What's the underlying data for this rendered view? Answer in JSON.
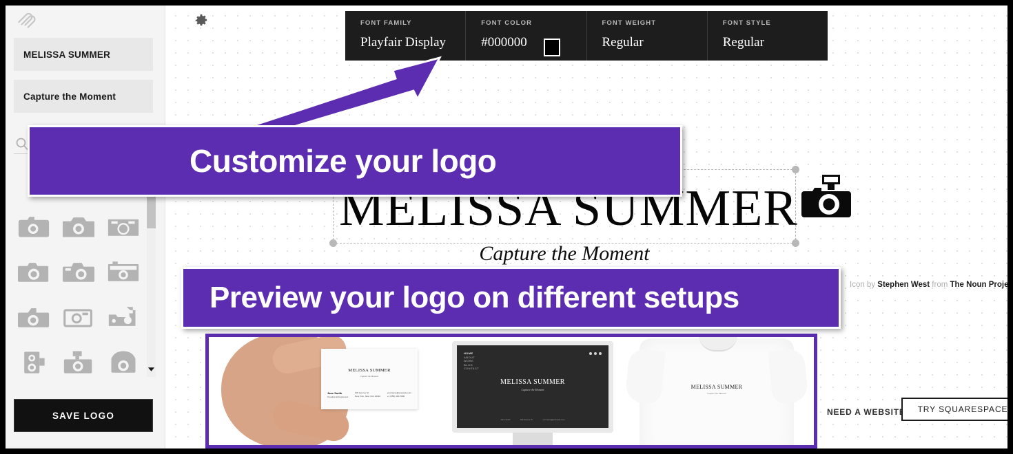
{
  "app": {
    "brand_icon": "squarespace-logo-icon",
    "accent_color": "#5c2db0",
    "canvas_bg": "#ffffff"
  },
  "sidebar": {
    "logo_name_field": {
      "label": "MELISSA SUMMER",
      "value": "MELISSA SUMMER"
    },
    "tagline_field": {
      "label": "Capture the Moment",
      "value": "Capture the Moment"
    },
    "search": {
      "icon": "search-icon",
      "placeholder": ""
    },
    "icon_grid": {
      "icon_name": "camera-icon",
      "rows": 4,
      "columns": 3,
      "count": 12
    },
    "save_button": "SAVE LOGO"
  },
  "toolbar": {
    "gear_icon": "gear-icon",
    "fields": [
      {
        "label": "FONT FAMILY",
        "value": "Playfair Display"
      },
      {
        "label": "FONT COLOR",
        "value": "#000000",
        "swatch": "#000000"
      },
      {
        "label": "FONT WEIGHT",
        "value": "Regular"
      },
      {
        "label": "FONT STYLE",
        "value": "Regular"
      }
    ]
  },
  "logo": {
    "title": "MELISSA SUMMER",
    "tagline": "Capture the Moment",
    "icon": "camera-with-flash-icon",
    "selected": true
  },
  "credit": {
    "prefix": "Icon by ",
    "author": "Stephen West",
    "middle": " from ",
    "source": "The Noun Project"
  },
  "previews": [
    {
      "name": "business-card",
      "logo": "MELISSA SUMMER",
      "tagline": "Capture the Moment",
      "contact_name": "Jane Smith",
      "contact_role": "Creative Entrepreneur",
      "address_line1": "100 Avenue St.",
      "address_line2": "New York, New York 10010",
      "email": "yourname@example.com",
      "phone": "+1 (555) 400-7800"
    },
    {
      "name": "website",
      "logo": "MELISSA SUMMER",
      "tagline": "Capture the Moment",
      "nav": [
        "HOME",
        "ABOUT",
        "WORK",
        "BLOG",
        "CONTACT"
      ],
      "footer": [
        "Jane Smith",
        "100 Avenue St.",
        "yourname@example.com"
      ]
    },
    {
      "name": "t-shirt",
      "logo": "MELISSA SUMMER",
      "tagline": "Capture the Moment"
    }
  ],
  "footer": {
    "need_website": "NEED A WEBSITE?",
    "cta": "TRY SQUARESPACE"
  },
  "callouts": [
    {
      "id": "customize",
      "text": "Customize your logo",
      "has_arrow": true
    },
    {
      "id": "preview",
      "text": "Preview your logo on different setups",
      "has_arrow": false
    }
  ]
}
